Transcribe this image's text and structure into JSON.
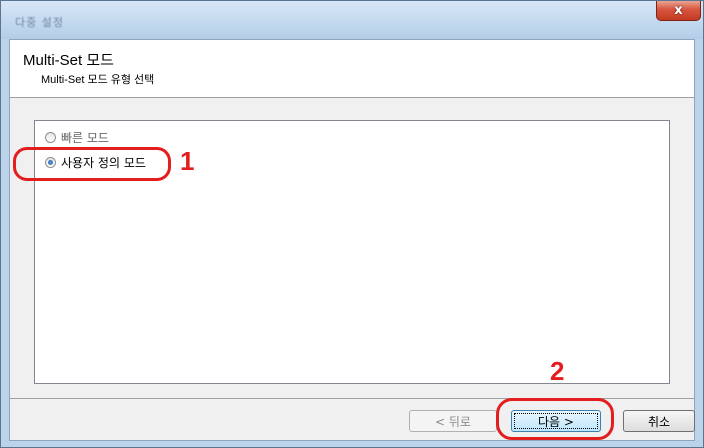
{
  "window": {
    "title": "다중 설정",
    "close_glyph": "x"
  },
  "header": {
    "title": "Multi-Set 모드",
    "subtitle": "Multi-Set 모드 유형 선택"
  },
  "options": [
    {
      "label": "빠른 모드",
      "checked": false
    },
    {
      "label": "사용자 정의 모드",
      "checked": true
    }
  ],
  "annotations": {
    "step1": "1",
    "step2": "2",
    "color": "#e31e1e"
  },
  "buttons": {
    "back": "< 뒤로",
    "next": "다음 >",
    "cancel": "취소"
  }
}
